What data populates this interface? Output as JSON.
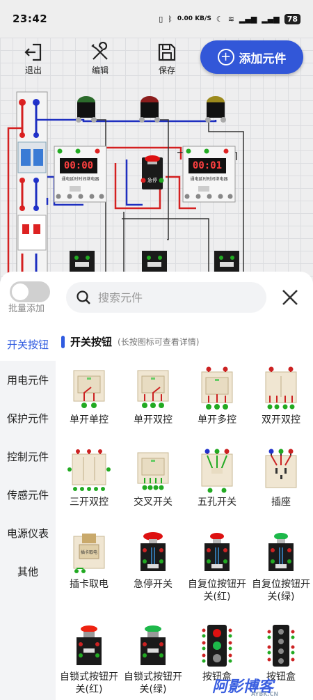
{
  "status_bar": {
    "time": "23:42",
    "speed": "0.00 KB/S",
    "battery": "78"
  },
  "toolbar": {
    "exit_label": "退出",
    "edit_label": "编辑",
    "save_label": "保存",
    "add_label": "添加元件"
  },
  "canvas": {
    "timer1_display": "00:00",
    "timer2_display": "00:01",
    "timer_caption": "通电延时时间继电器",
    "estop_caption": "急停"
  },
  "sheet": {
    "batch_add_label": "批量添加",
    "search_placeholder": "搜索元件",
    "section_title": "开关按钮",
    "section_hint": "(长按图标可查看详情)"
  },
  "sidebar": {
    "items": [
      {
        "label": "开关按钮"
      },
      {
        "label": "用电元件"
      },
      {
        "label": "保护元件"
      },
      {
        "label": "控制元件"
      },
      {
        "label": "传感元件"
      },
      {
        "label": "电源仪表"
      },
      {
        "label": "其他"
      }
    ]
  },
  "components": [
    {
      "name": "单开单控",
      "icon": "single-switch-icon"
    },
    {
      "name": "单开双控",
      "icon": "single-two-way-switch-icon"
    },
    {
      "name": "单开多控",
      "icon": "single-multi-switch-icon"
    },
    {
      "name": "双开双控",
      "icon": "double-switch-icon"
    },
    {
      "name": "三开双控",
      "icon": "triple-switch-icon"
    },
    {
      "name": "交叉开关",
      "icon": "cross-switch-icon"
    },
    {
      "name": "五孔开关",
      "icon": "five-hole-switch-icon"
    },
    {
      "name": "插座",
      "icon": "socket-icon"
    },
    {
      "name": "插卡取电",
      "icon": "card-power-icon"
    },
    {
      "name": "急停开关",
      "icon": "emergency-stop-icon"
    },
    {
      "name": "自复位按钮开关(红)",
      "icon": "red-reset-button-icon"
    },
    {
      "name": "自复位按钮开关(绿)",
      "icon": "green-reset-button-icon"
    },
    {
      "name": "自锁式按钮开关(红)",
      "icon": "red-latch-button-icon"
    },
    {
      "name": "自锁式按钮开关(绿)",
      "icon": "green-latch-button-icon"
    },
    {
      "name": "按钮盒",
      "icon": "button-box-icon"
    },
    {
      "name": "按钮盒",
      "icon": "button-box-icon"
    }
  ],
  "watermark": {
    "text": "阿影博客",
    "sub": "AYBK.CN"
  },
  "colors": {
    "accent": "#2f5be0",
    "add_button": "#3257d8",
    "wire_red": "#d42020",
    "wire_blue": "#1e2fc0"
  }
}
